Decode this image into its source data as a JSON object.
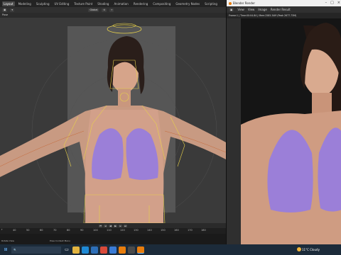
{
  "blender": {
    "workspace_tabs": [
      "Layout",
      "Modeling",
      "Sculpting",
      "UV Editing",
      "Texture Paint",
      "Shading",
      "Animation",
      "Rendering",
      "Compositing",
      "Geometry Nodes",
      "Scripting"
    ],
    "active_tab": "Layout",
    "transform_orientation": "Global",
    "mode_label": "Pose",
    "timeline": {
      "start_label": "r",
      "ticks": [
        "40",
        "50",
        "60",
        "70",
        "80",
        "90",
        "100",
        "110",
        "120",
        "130",
        "140",
        "150",
        "160",
        "170",
        "180"
      ]
    },
    "status": {
      "left": "Rotate View",
      "middle": "Pose Context Menu"
    }
  },
  "render_window": {
    "title": "Blender Render",
    "menu": [
      "View",
      "View",
      "Image"
    ],
    "menu_extra": "Render Result",
    "info": "Frame:1 | Time:00:04.84 | Mem:2585.34M (Peak 2677.73M)"
  },
  "taskbar": {
    "weather": "11°C  Cloudy",
    "icons": [
      "windows-logo",
      "search",
      "task-view",
      "file-explorer",
      "edge",
      "mail",
      "chrome",
      "photos",
      "blender",
      "3d-app",
      "blender-active"
    ]
  },
  "colors": {
    "bone_yellow": "#e8d24a",
    "bikini": "#9b7fd8",
    "skin": "#d6a48a",
    "viewport_bg": "#3a3a3a"
  }
}
